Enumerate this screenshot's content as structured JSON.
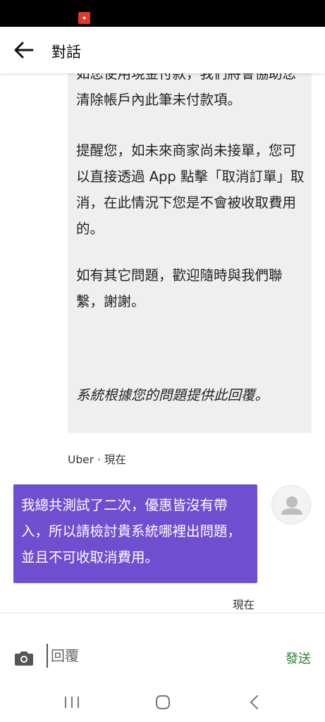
{
  "status_bar": {
    "app_icon": "app-notification-icon"
  },
  "header": {
    "title": "對話",
    "back_icon": "arrow-left-icon"
  },
  "support_message": {
    "para1": "如您使用現金付款，我們將會協助您清除帳戶內此筆未付款項。",
    "para2": "提醒您，如未來商家尚未接單，您可以直接透過 App 點擊「取消訂單」取消，在此情況下您是不會被收取費用的。",
    "para3": "如有其它問題，歡迎隨時與我們聯繫，謝謝。",
    "auto_note": "系統根據您的問題提供此回覆。",
    "sender": "Uber",
    "separator": " · ",
    "time": "現在"
  },
  "user_message": {
    "text": "我總共測試了二次，優惠皆沒有帶入，所以請檢討貴系統哪裡出問題，並且不可收取消費用。",
    "time": "現在",
    "avatar_icon": "user-avatar-icon"
  },
  "composer": {
    "placeholder": "回覆",
    "value": "",
    "send_label": "發送",
    "camera_icon": "camera-icon"
  },
  "nav_bar": {
    "recents_icon": "recents-icon",
    "home_icon": "home-icon",
    "back_icon": "back-icon"
  },
  "colors": {
    "user_bubble": "#6f4fcf",
    "support_bubble": "#efefef",
    "send": "#2e7d32"
  }
}
